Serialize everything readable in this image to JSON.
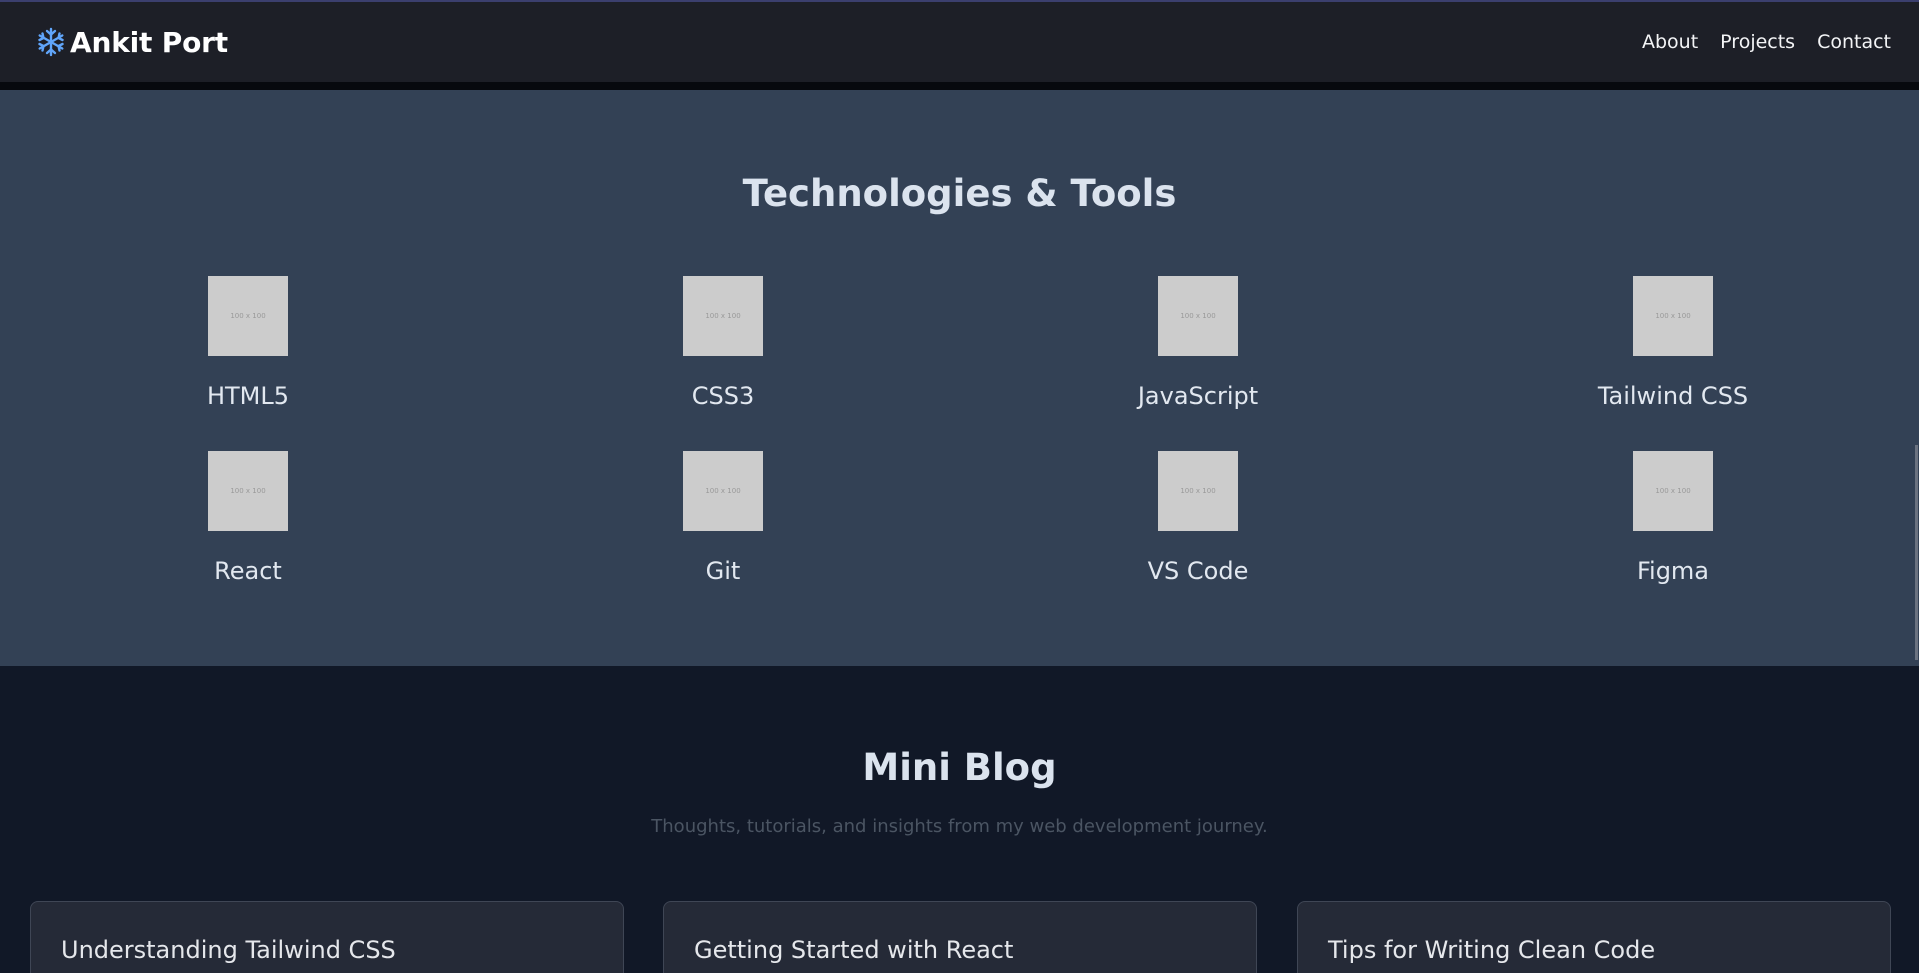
{
  "navbar": {
    "brand": "Ankit Port",
    "brand_icon": "snowflake-icon",
    "links": [
      "About",
      "Projects",
      "Contact"
    ]
  },
  "tech": {
    "title": "Technologies & Tools",
    "placeholder_text": "100 x 100",
    "items": [
      {
        "name": "HTML5"
      },
      {
        "name": "CSS3"
      },
      {
        "name": "JavaScript"
      },
      {
        "name": "Tailwind CSS"
      },
      {
        "name": "React"
      },
      {
        "name": "Git"
      },
      {
        "name": "VS Code"
      },
      {
        "name": "Figma"
      }
    ]
  },
  "blog": {
    "title": "Mini Blog",
    "subtitle": "Thoughts, tutorials, and insights from my web development journey.",
    "posts": [
      {
        "title": "Understanding Tailwind CSS"
      },
      {
        "title": "Getting Started with React"
      },
      {
        "title": "Tips for Writing Clean Code"
      }
    ]
  },
  "colors": {
    "navbar_bg": "#1d1f27",
    "tech_bg": "#334155",
    "blog_bg": "#111827",
    "brand_icon": "#60a5fa"
  }
}
